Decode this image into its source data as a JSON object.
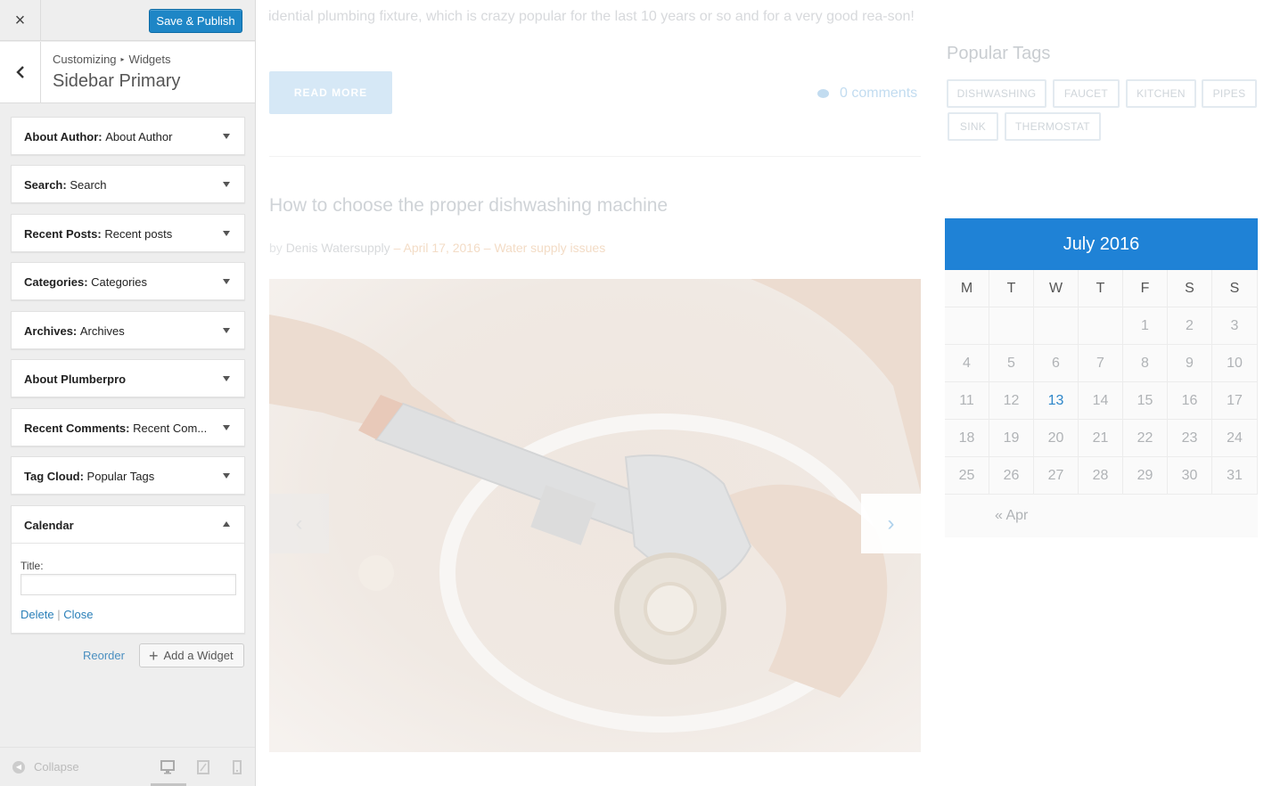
{
  "header": {
    "close_label": "×",
    "publish_label": "Save & Publish"
  },
  "section": {
    "crumb_root": "Customizing",
    "crumb_sep": "▸",
    "crumb_leaf": "Widgets",
    "title": "Sidebar Primary"
  },
  "widgets": [
    {
      "type": "About Author",
      "title": "About Author"
    },
    {
      "type": "Search",
      "title": "Search"
    },
    {
      "type": "Recent Posts",
      "title": "Recent posts"
    },
    {
      "type": "Categories",
      "title": "Categories"
    },
    {
      "type": "Archives",
      "title": "Archives"
    },
    {
      "type": "About Plumberpro",
      "title": ""
    },
    {
      "type": "Recent Comments",
      "title": "Recent Com..."
    },
    {
      "type": "Tag Cloud",
      "title": "Popular Tags"
    }
  ],
  "calendar_widget": {
    "label": "Calendar",
    "title_label": "Title:",
    "title_value": "",
    "delete_label": "Delete",
    "separator": "|",
    "close_label": "Close"
  },
  "actions": {
    "reorder_label": "Reorder",
    "add_widget_label": "Add a Widget"
  },
  "footer": {
    "collapse_label": "Collapse",
    "active_device": "desktop"
  },
  "preview": {
    "excerpt": "idential plumbing fixture, which is crazy popular for the last 10 years or so and for a very good rea-son!",
    "read_more_label": "READ MORE",
    "comments_label": "0 comments",
    "post_title": "How to choose the proper dishwashing machine",
    "meta_by": "by",
    "meta_author": "Denis Watersupply",
    "meta_dash1": "–",
    "meta_date": "April 17, 2016",
    "meta_dash2": "–",
    "meta_category": "Water supply issues",
    "prev_arrow": "‹",
    "next_arrow": "›"
  },
  "popular_tags": {
    "title": "Popular Tags",
    "tags": [
      "DISHWASHING",
      "FAUCET",
      "KITCHEN",
      "PIPES",
      "SINK",
      "THERMOSTAT"
    ]
  },
  "calendar": {
    "month_label": "July 2016",
    "weekdays": [
      "M",
      "T",
      "W",
      "T",
      "F",
      "S",
      "S"
    ],
    "weeks": [
      [
        "",
        "",
        "",
        "",
        "1",
        "2",
        "3"
      ],
      [
        "4",
        "5",
        "6",
        "7",
        "8",
        "9",
        "10"
      ],
      [
        "11",
        "12",
        "13",
        "14",
        "15",
        "16",
        "17"
      ],
      [
        "18",
        "19",
        "20",
        "21",
        "22",
        "23",
        "24"
      ],
      [
        "25",
        "26",
        "27",
        "28",
        "29",
        "30",
        "31"
      ]
    ],
    "today": "13",
    "prev_label": "« Apr"
  },
  "colors": {
    "publish_blue": "#1e86c6",
    "calendar_header": "#1f82d6",
    "link_blue": "#2a7fb8"
  }
}
